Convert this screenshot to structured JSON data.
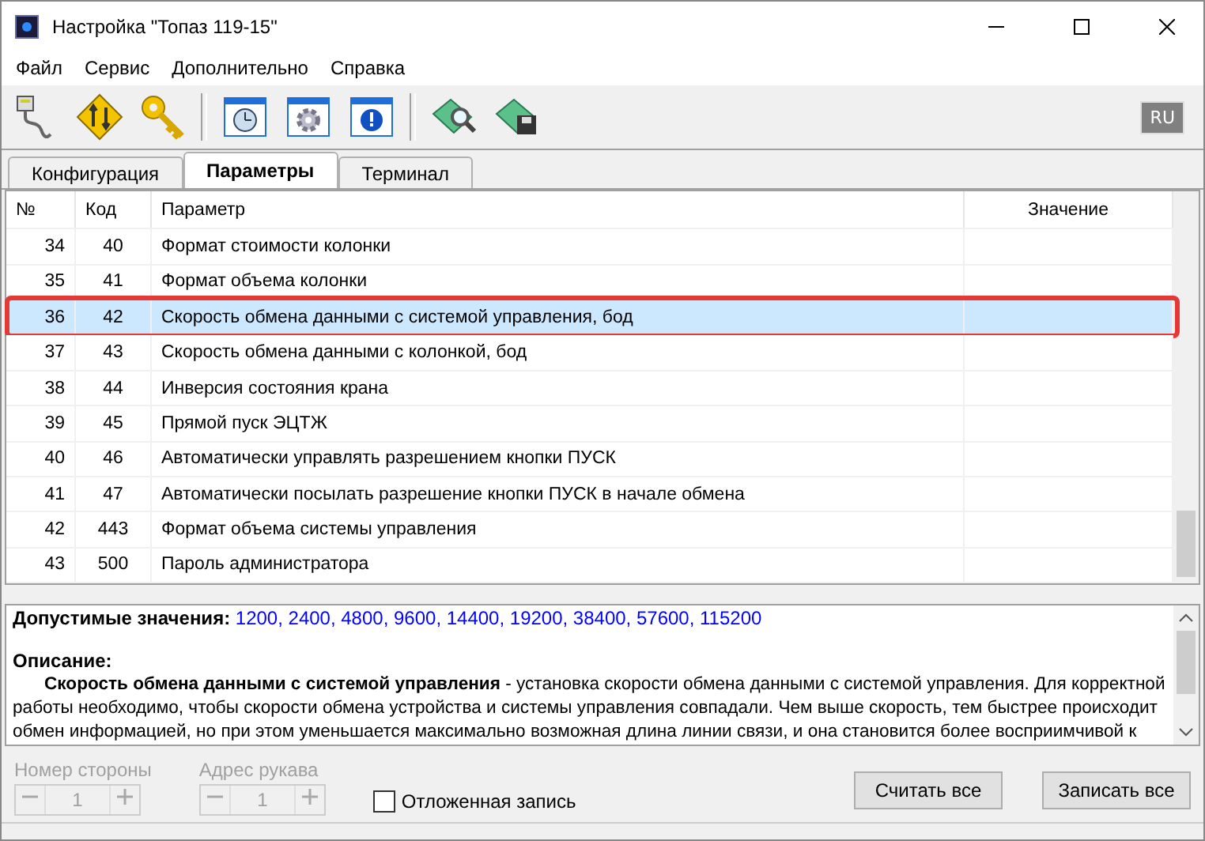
{
  "window": {
    "title": "Настройка \"Топаз 119-15\""
  },
  "menu": [
    "Файл",
    "Сервис",
    "Дополнительно",
    "Справка"
  ],
  "language": "RU",
  "tabs": [
    {
      "label": "Конфигурация",
      "selected": false
    },
    {
      "label": "Параметры",
      "selected": true
    },
    {
      "label": "Терминал",
      "selected": false
    }
  ],
  "table": {
    "columns": [
      "№",
      "Код",
      "Параметр",
      "Значение"
    ],
    "rows": [
      {
        "num": "34",
        "code": "40",
        "name": "Формат стоимости колонки",
        "selected": false
      },
      {
        "num": "35",
        "code": "41",
        "name": "Формат объема колонки",
        "selected": false
      },
      {
        "num": "36",
        "code": "42",
        "name": "Скорость обмена данными с системой управления, бод",
        "selected": true
      },
      {
        "num": "37",
        "code": "43",
        "name": "Скорость обмена данными с колонкой, бод",
        "selected": false
      },
      {
        "num": "38",
        "code": "44",
        "name": "Инверсия состояния крана",
        "selected": false
      },
      {
        "num": "39",
        "code": "45",
        "name": "Прямой пуск ЭЦТЖ",
        "selected": false
      },
      {
        "num": "40",
        "code": "46",
        "name": "Автоматически управлять разрешением кнопки ПУСК",
        "selected": false
      },
      {
        "num": "41",
        "code": "47",
        "name": "Автоматически посылать разрешение кнопки ПУСК в начале обмена",
        "selected": false
      },
      {
        "num": "42",
        "code": "443",
        "name": "Формат объема системы управления",
        "selected": false
      },
      {
        "num": "43",
        "code": "500",
        "name": "Пароль администратора",
        "selected": false
      }
    ]
  },
  "info": {
    "allowed_label": "Допустимые значения:",
    "allowed_values": "1200, 2400, 4800, 9600, 14400, 19200, 38400, 57600, 115200",
    "description_label": "Описание:",
    "description_lines": [
      "**Скорость обмена данными с системой управления** - установка скорости обмена данными с системой управления. Для корректной",
      "работы необходимо, чтобы скорости обмена устройства и системы управления совпадали. Чем выше скорость, тем быстрее происходит",
      "обмен информацией, но при этом уменьшается максимально возможная длина линии связи, и она становится более восприимчивой к"
    ]
  },
  "spinners": [
    {
      "label": "Номер стороны",
      "value": "1",
      "disabled": true
    },
    {
      "label": "Адрес рукава",
      "value": "1",
      "disabled": true
    }
  ],
  "deferred_write": {
    "label": "Отложенная запись",
    "checked": false
  },
  "buttons": [
    "Считать все",
    "Записать все"
  ]
}
